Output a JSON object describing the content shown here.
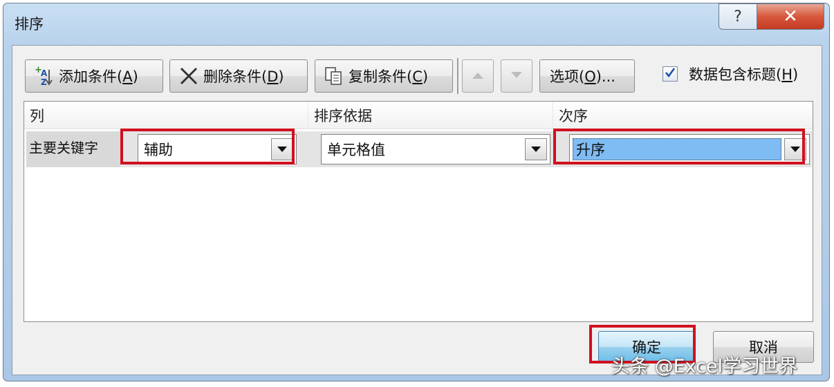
{
  "window": {
    "title": "排序"
  },
  "caption": {
    "help_label": "?",
    "close_label": "✕"
  },
  "toolbar": {
    "add_prefix": "添加条件(",
    "add_key": "A",
    "add_suffix": ")",
    "delete_prefix": "删除条件(",
    "delete_key": "D",
    "delete_suffix": ")",
    "copy_prefix": "复制条件(",
    "copy_key": "C",
    "copy_suffix": ")",
    "options_prefix": "选项(",
    "options_key": "O",
    "options_suffix": ")...",
    "has_headers_prefix": "数据包含标题(",
    "has_headers_key": "H",
    "has_headers_suffix": ")",
    "has_headers_checked": true
  },
  "grid": {
    "columns": [
      "列",
      "排序依据",
      "次序"
    ],
    "rows": [
      {
        "label": "主要关键字",
        "column": "辅助",
        "sort_on": "单元格值",
        "order": "升序"
      }
    ]
  },
  "footer": {
    "ok_label": "确定",
    "cancel_label": "取消"
  },
  "watermark": "头条 @Excel学习世界",
  "colors": {
    "highlight": "#d0101e",
    "selection": "#7fbcf4",
    "ok_button": "#98d1ef"
  }
}
